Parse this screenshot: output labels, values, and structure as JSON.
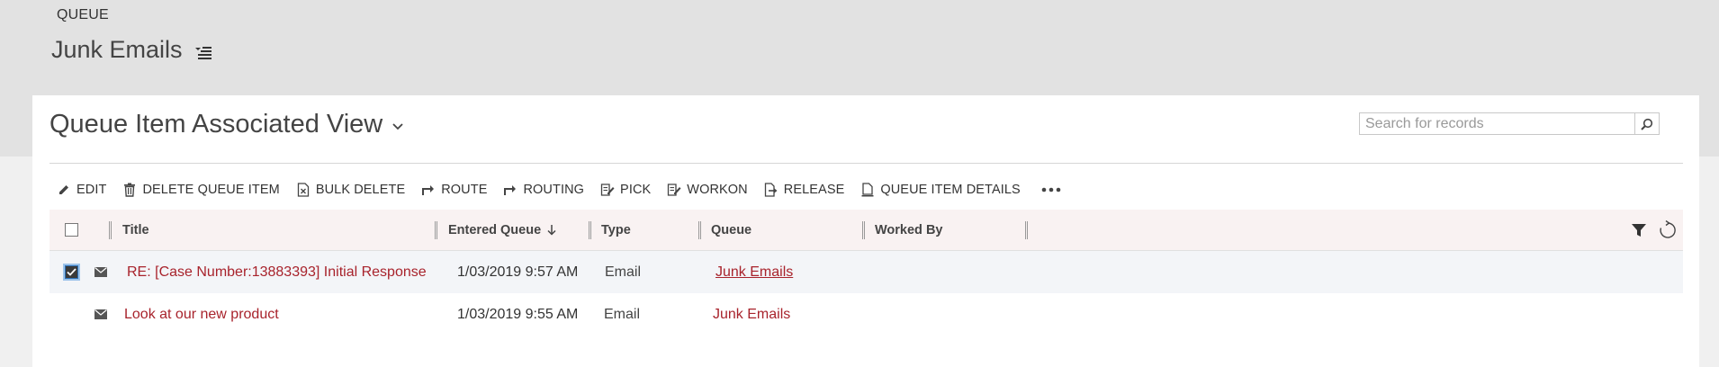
{
  "header": {
    "entity_type": "QUEUE",
    "record_title": "Junk Emails"
  },
  "view": {
    "title": "Queue Item Associated View"
  },
  "search": {
    "placeholder": "Search for records",
    "value": ""
  },
  "toolbar": {
    "buttons": [
      {
        "label": "EDIT",
        "icon": "pencil-icon"
      },
      {
        "label": "DELETE QUEUE ITEM",
        "icon": "trash-icon"
      },
      {
        "label": "BULK DELETE",
        "icon": "bulk-delete-icon"
      },
      {
        "label": "ROUTE",
        "icon": "route-arrow-icon"
      },
      {
        "label": "ROUTING",
        "icon": "routing-arrow-icon"
      },
      {
        "label": "PICK",
        "icon": "pick-icon"
      },
      {
        "label": "WORKON",
        "icon": "workon-icon"
      },
      {
        "label": "RELEASE",
        "icon": "release-icon"
      },
      {
        "label": "QUEUE ITEM DETAILS",
        "icon": "details-icon"
      }
    ],
    "more_icon": "ellipsis-icon"
  },
  "grid": {
    "columns": {
      "title": "Title",
      "entered_queue": "Entered Queue",
      "type": "Type",
      "queue": "Queue",
      "worked_by": "Worked By"
    },
    "sort_icon": "sort-down-arrow-icon",
    "rows": [
      {
        "selected": true,
        "title": "RE: [Case Number:13883393] Initial Response",
        "entered_queue": "1/03/2019 9:57 AM",
        "type": "Email",
        "queue": "Junk Emails",
        "worked_by": ""
      },
      {
        "selected": false,
        "title": "Look at our new product",
        "entered_queue": "1/03/2019 9:55 AM",
        "type": "Email",
        "queue": "Junk Emails",
        "worked_by": ""
      }
    ]
  },
  "colors": {
    "accent_red": "#a8232c",
    "top_band": "#e2e2e2",
    "header_bg": "#f9f2f2"
  }
}
